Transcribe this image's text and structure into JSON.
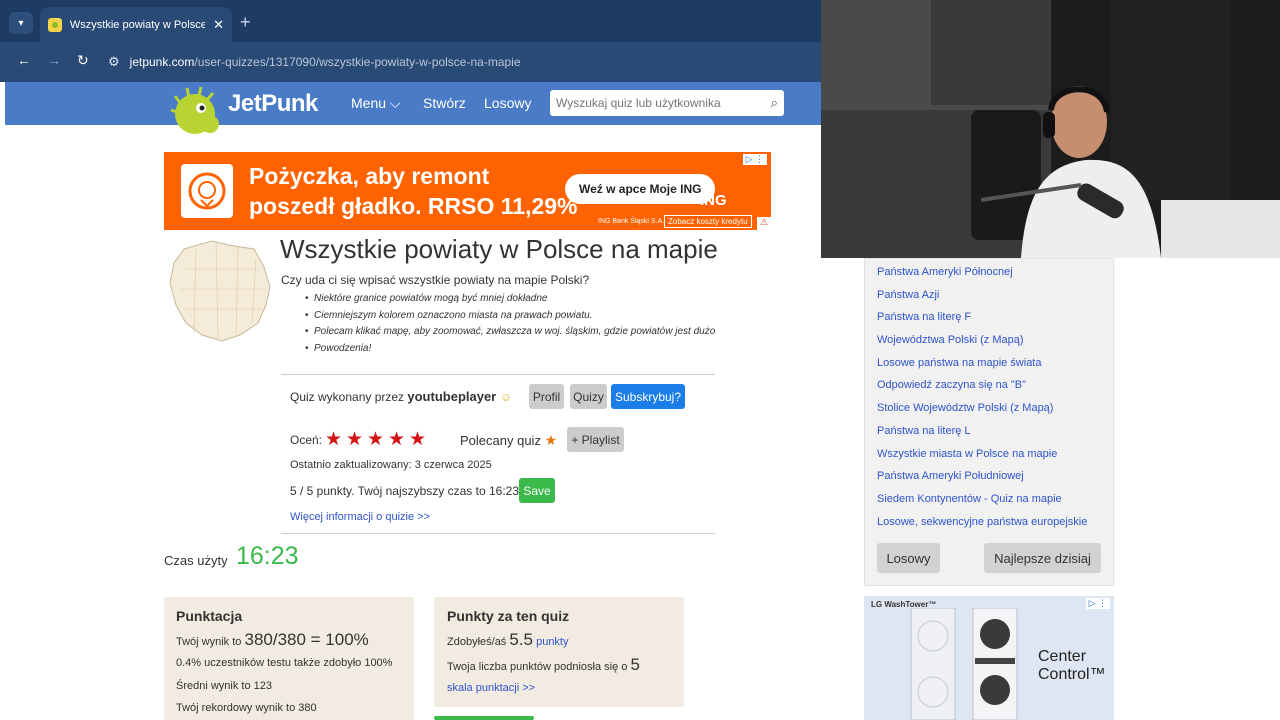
{
  "browser": {
    "tab_title": "Wszystkie powiaty w Polsce na ma",
    "tab_close": "✕",
    "new_tab": "+",
    "url_host": "jetpunk.com",
    "url_path": "/user-quizzes/1317090/wszystkie-powiaty-w-polsce-na-mapie",
    "icons": [
      "tab-search-icon",
      "back-icon",
      "forward-icon",
      "reload-icon",
      "site-info-icon"
    ]
  },
  "site": {
    "logo_text": "JetPunk",
    "menu": "Menu",
    "create": "Stwórz",
    "random": "Losowy",
    "search_placeholder": "Wyszukaj quiz lub użytkownika",
    "header_color": "#4a7bc7"
  },
  "ad_top": {
    "line1": "Pożyczka, aby remont",
    "line2": "poszedł gładko. RRSO 11,29%",
    "cta": "Weź w apce Moje ING",
    "brand": "ING",
    "legal": "ING Bank Śląski S.A.",
    "costs": "Zobacz koszty kredytu",
    "color": "#ff6200"
  },
  "quiz": {
    "title": "Wszystkie powiaty w Polsce na mapie",
    "description": "Czy uda ci się wpisać wszystkie powiaty na mapie Polski?",
    "notes": [
      "Niektóre granice powiatów mogą być mniej dokładne",
      "Ciemniejszym kolorem oznaczono miasta na prawach powiatu.",
      "Polecam klikać mapę, aby zoomować, zwłaszcza w woj. śląskim, gdzie powiatów jest dużo",
      "Powodzenia!"
    ],
    "author_prefix": "Quiz wykonany przez",
    "author": "youtubeplayer",
    "profile_btn": "Profil",
    "quizzes_btn": "Quizy",
    "subscribe_btn": "Subskrybuj?",
    "rate_label": "Oceń:",
    "rating_stars": 5,
    "featured": "Polecany quiz",
    "playlist_btn": "+ Playlist",
    "updated": "Ostatnio zaktualizowany: 3 czerwca 2025",
    "score_text": "5 / 5 punkty. Twój najszybszy czas to 16:23.",
    "save_btn": "Save",
    "more_info": "Więcej informacji o quizie >>",
    "time_label": "Czas użyty",
    "time_value": "16:23"
  },
  "scoring": {
    "title": "Punktacja",
    "line1_prefix": "Twój wynik to",
    "line1_value": "380/380 = 100%",
    "line2": "0.4% uczestników testu także zdobyło 100%",
    "line3": "Średni wynik to 123",
    "line4": "Twój rekordowy wynik to 380"
  },
  "points": {
    "title": "Punkty za ten quiz",
    "line1_prefix": "Zdobyłeś/aś",
    "line1_value": "5.5",
    "line1_link": "punkty",
    "line2_prefix": "Twoja liczba punktów podniosła się o",
    "line2_value": "5",
    "scale_link": "skala punktacji >>"
  },
  "sidebar": {
    "links": [
      "Państwa Ameryki Północnej",
      "Państwa Azji",
      "Państwa na literę F",
      "Województwa Polski (z Mapą)",
      "Losowe państwa na mapie świata",
      "Odpowiedź zaczyna się na \"B\"",
      "Stolice Województw Polski (z Mapą)",
      "Państwa na literę L",
      "Wszystkie miasta w Polsce na mapie",
      "Państwa Ameryki Południowej",
      "Siedem Kontynentów - Quiz na mapie",
      "Losowe, sekwencyjne państwa europejskie"
    ],
    "random_btn": "Losowy",
    "best_today_btn": "Najlepsze dzisiaj"
  },
  "ad_side": {
    "brand": "LG WashTower™",
    "line1": "Center",
    "line2": "Control™"
  }
}
